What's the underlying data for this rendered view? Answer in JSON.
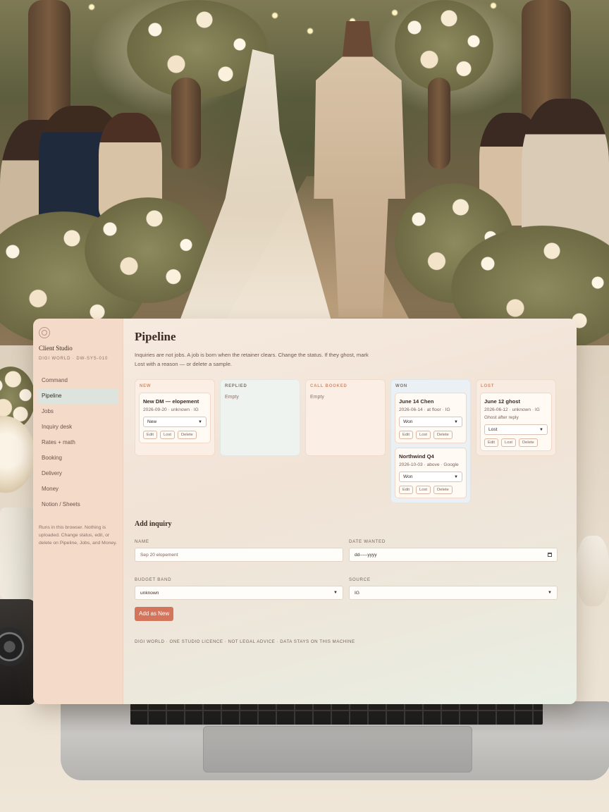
{
  "sidebar": {
    "brand": "Client Studio",
    "brand_sub": "DIGI WORLD · DW-SYS-010",
    "items": [
      {
        "label": "Command"
      },
      {
        "label": "Pipeline"
      },
      {
        "label": "Jobs"
      },
      {
        "label": "Inquiry desk"
      },
      {
        "label": "Rates + math"
      },
      {
        "label": "Booking"
      },
      {
        "label": "Delivery"
      },
      {
        "label": "Money"
      },
      {
        "label": "Notion / Sheets"
      }
    ],
    "active": "Pipeline",
    "note": "Runs in this browser. Nothing is uploaded. Change status, edit, or delete on Pipeline, Jobs, and Money."
  },
  "main": {
    "title": "Pipeline",
    "description": "Inquiries are not jobs. A job is born when the retainer clears. Change the status. If they ghost, mark Lost with a reason — or delete a sample."
  },
  "board": {
    "columns": [
      {
        "title": "NEW",
        "empty_label": "",
        "cards": [
          {
            "title": "New DM — elopement",
            "meta": "2026-09-20 · unknown · IG",
            "note": "",
            "status": "New"
          }
        ]
      },
      {
        "title": "REPLIED",
        "empty_label": "Empty",
        "cards": []
      },
      {
        "title": "CALL BOOKED",
        "empty_label": "Empty",
        "cards": []
      },
      {
        "title": "WON",
        "empty_label": "",
        "cards": [
          {
            "title": "June 14 Chen",
            "meta": "2026-06-14 · at floor · IG",
            "note": "",
            "status": "Won"
          },
          {
            "title": "Northwind Q4",
            "meta": "2026-10-03 · above · Google",
            "note": "",
            "status": "Won"
          }
        ]
      },
      {
        "title": "LOST",
        "empty_label": "",
        "cards": [
          {
            "title": "June 12 ghost",
            "meta": "2026-06-12 · unknown · IG",
            "note": "Ghost after reply",
            "status": "Lost"
          }
        ]
      }
    ],
    "actions": {
      "edit": "Edit",
      "lost": "Lost",
      "delete": "Delete"
    }
  },
  "add_inquiry": {
    "title": "Add inquiry",
    "name_label": "NAME",
    "name_value": "Sep 20 elopement",
    "date_label": "DATE WANTED",
    "date_value": "dd-----yyyy",
    "budget_label": "BUDGET BAND",
    "budget_value": "unknown",
    "source_label": "SOURCE",
    "source_value": "IG",
    "submit_label": "Add as New"
  },
  "footer": "DIGI WORLD · ONE STUDIO LICENCE · NOT LEGAL ADVICE · DATA STAYS ON THIS MACHINE",
  "colors": {
    "sidebar_bg": "#f4dac9",
    "accent": "#d4745a",
    "column_heading_accent": "#cf8d6c",
    "active_nav": "#dde4de"
  }
}
